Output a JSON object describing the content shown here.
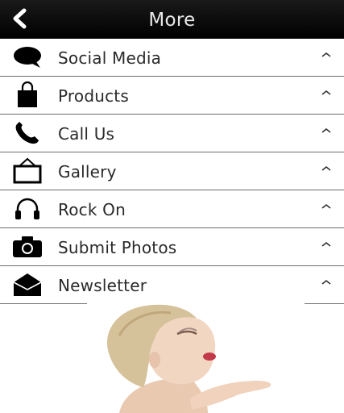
{
  "header": {
    "title": "More",
    "back_icon": "chevron-left-icon"
  },
  "menu": {
    "items": [
      {
        "label": "Social Media",
        "icon": "speech-bubble-icon"
      },
      {
        "label": "Products",
        "icon": "shopping-bag-icon"
      },
      {
        "label": "Call Us",
        "icon": "phone-icon"
      },
      {
        "label": "Gallery",
        "icon": "picture-frame-icon"
      },
      {
        "label": "Rock On",
        "icon": "headphones-icon"
      },
      {
        "label": "Submit Photos",
        "icon": "camera-icon"
      },
      {
        "label": "Newsletter",
        "icon": "envelope-icon"
      }
    ],
    "chevron_icon": "chevron-up-icon"
  },
  "banner": {
    "image": "woman-blowing-kiss-photo"
  },
  "colors": {
    "header_bg": "#000000",
    "header_text": "#e8e8e8",
    "row_bg": "#ffffff",
    "row_text": "#2a2a2a",
    "divider": "#6e6e6e"
  }
}
